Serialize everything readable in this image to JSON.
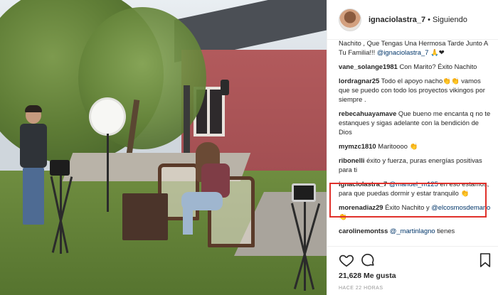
{
  "post": {
    "username": "ignaciolastra_7",
    "separator": "•",
    "follow_status": "Siguiendo"
  },
  "comments": [
    {
      "user": "",
      "text": "Nachito , Que Tengas Una Hermosa Tarde Junto A Tu Familia!!! ",
      "mention": "@ignaciolastra_7",
      "after": " 🙏❤"
    },
    {
      "user": "vane_solange1981",
      "text": " Con Marito? Éxito Nachito",
      "mention": "",
      "after": ""
    },
    {
      "user": "lordragnar25",
      "text": " Todo el apoyo nacho👏👏 vamos que se puedo con todo los proyectos vikingos por siempre .",
      "mention": "",
      "after": ""
    },
    {
      "user": "rebecahuayamave",
      "text": " Que bueno me encanta q no te estanques y sigas adelante con la bendición de Dios",
      "mention": "",
      "after": ""
    },
    {
      "user": "mymzc1810",
      "text": " Maritoooo 👏",
      "mention": "",
      "after": ""
    },
    {
      "user": "ribonelli",
      "text": " éxito y fuerza, puras energías positivas para ti",
      "mention": "",
      "after": ""
    },
    {
      "user": "ignaciolastra_7",
      "text": " ",
      "mention": "@manuel_m125",
      "after": " en eso estamos, para que puedas dormir y estar tranquilo 👏"
    },
    {
      "user": "morenadiaz29",
      "text": " Éxito Nachito y ",
      "mention": "@elcosmosdemario",
      "after": " 👏"
    },
    {
      "user": "carolinemontss",
      "text": " ",
      "mention": "@_martinlagno",
      "after": " tienes"
    }
  ],
  "likes": "21,628 Me gusta",
  "time": "HACE 22 HORAS",
  "colors": {
    "highlight": "#e0312b",
    "mention": "#003569",
    "text": "#262626"
  },
  "icons": [
    "heart-icon",
    "comment-icon",
    "bookmark-icon"
  ]
}
